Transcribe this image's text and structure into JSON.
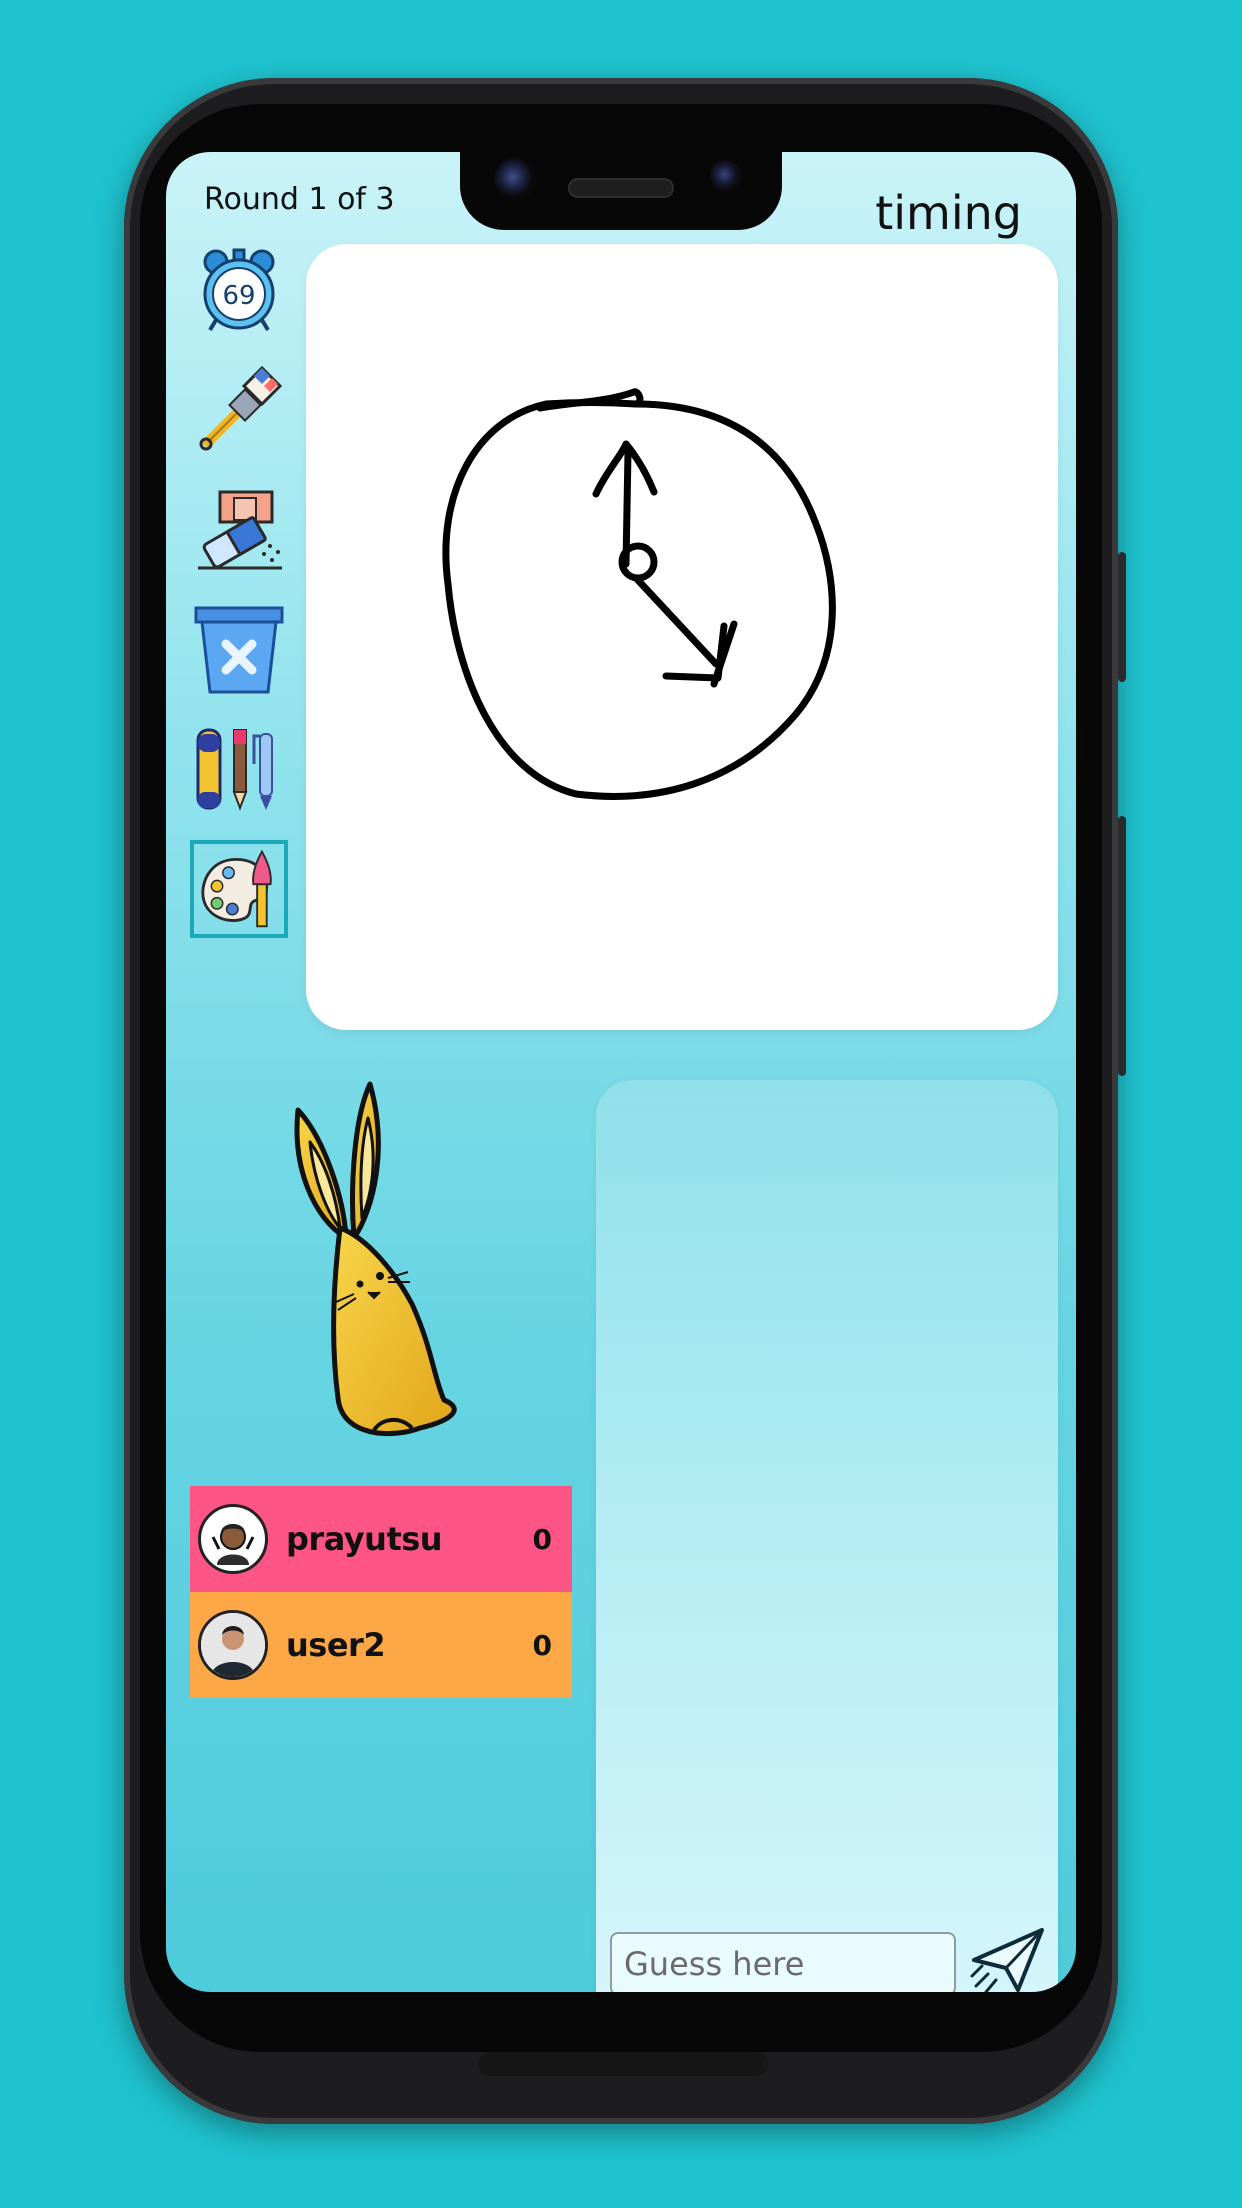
{
  "header": {
    "round_label": "Round 1 of 3",
    "word": "timing"
  },
  "toolbar": {
    "timer_value": "69",
    "tools": [
      "timer-icon",
      "brush-icon",
      "eraser-icon",
      "trash-icon",
      "pens-icon",
      "palette-icon"
    ],
    "selected": "palette-icon"
  },
  "players": [
    {
      "name": "prayutsu",
      "score": "0",
      "color": "#fe5587"
    },
    {
      "name": "user2",
      "score": "0",
      "color": "#fda847"
    }
  ],
  "chat": {
    "placeholder": "Guess here"
  },
  "colors": {
    "background": "#1ec3cf",
    "accent": "#1aa9b8"
  }
}
